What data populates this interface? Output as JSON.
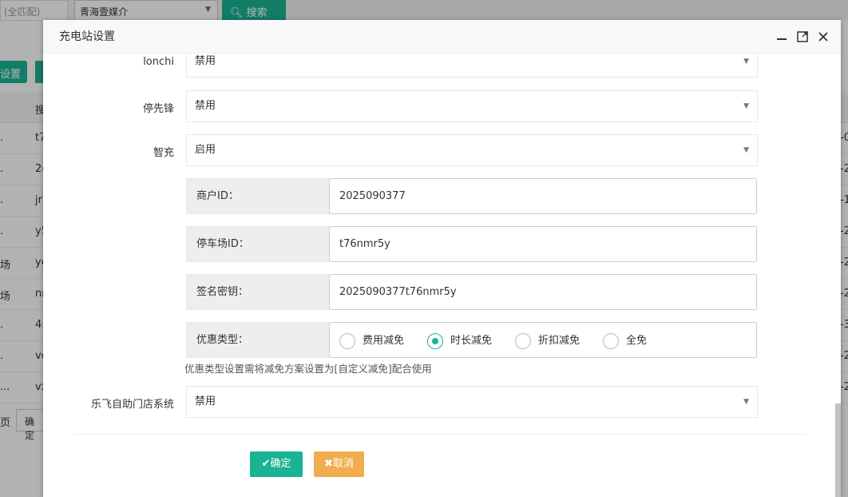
{
  "background": {
    "match_placeholder": "(全匹配)",
    "org_select_value": "青海壹媒介",
    "search_label": "搜索",
    "settings_label": "设置",
    "table_header_partial": "搜",
    "rows": [
      {
        "c0": ".",
        "c1": "t7",
        "c2": "-0"
      },
      {
        "c0": ".",
        "c1": "2(",
        "c2": "-2"
      },
      {
        "c0": ".",
        "c1": "jr",
        "c2": "-1"
      },
      {
        "c0": ".",
        "c1": "y5",
        "c2": "-2"
      },
      {
        "c0": "场",
        "c1": "ye",
        "c2": "-2"
      },
      {
        "c0": "场",
        "c1": "nr",
        "c2": "-2"
      },
      {
        "c0": ".",
        "c1": "4:",
        "c2": "-3"
      },
      {
        "c0": ".",
        "c1": "vc",
        "c2": "-2"
      },
      {
        "c0": "...",
        "c1": "vx",
        "c2": "-2"
      }
    ],
    "pager_label": "页",
    "pager_confirm": "确定"
  },
  "dialog": {
    "title": "充电站设置",
    "fields": [
      {
        "label": "lonchi",
        "value": "禁用"
      },
      {
        "label": "停先锋",
        "value": "禁用"
      },
      {
        "label": "智充",
        "value": "启用"
      }
    ],
    "inputs": [
      {
        "addon": "商户ID：",
        "value": "2025090377"
      },
      {
        "addon": "停车场ID：",
        "value": "t76nmr5y"
      },
      {
        "addon": "签名密钥：",
        "value": "2025090377t76nmr5y"
      }
    ],
    "discount": {
      "addon": "优惠类型：",
      "options": [
        "费用减免",
        "时长减免",
        "折扣减免",
        "全免"
      ],
      "selected": "时长减免"
    },
    "hint": "优惠类型设置需将减免方案设置为[自定义减免]配合使用",
    "lefei": {
      "label": "乐飞自助门店系统",
      "value": "禁用"
    },
    "ok_label": "确定",
    "cancel_label": "取消"
  }
}
